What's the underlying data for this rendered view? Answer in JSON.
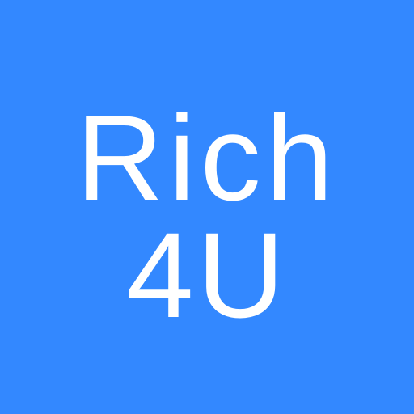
{
  "colors": {
    "background": "#3388ff",
    "text": "#ffffff"
  },
  "logo": {
    "line1": "Rich",
    "line2": "4U"
  }
}
